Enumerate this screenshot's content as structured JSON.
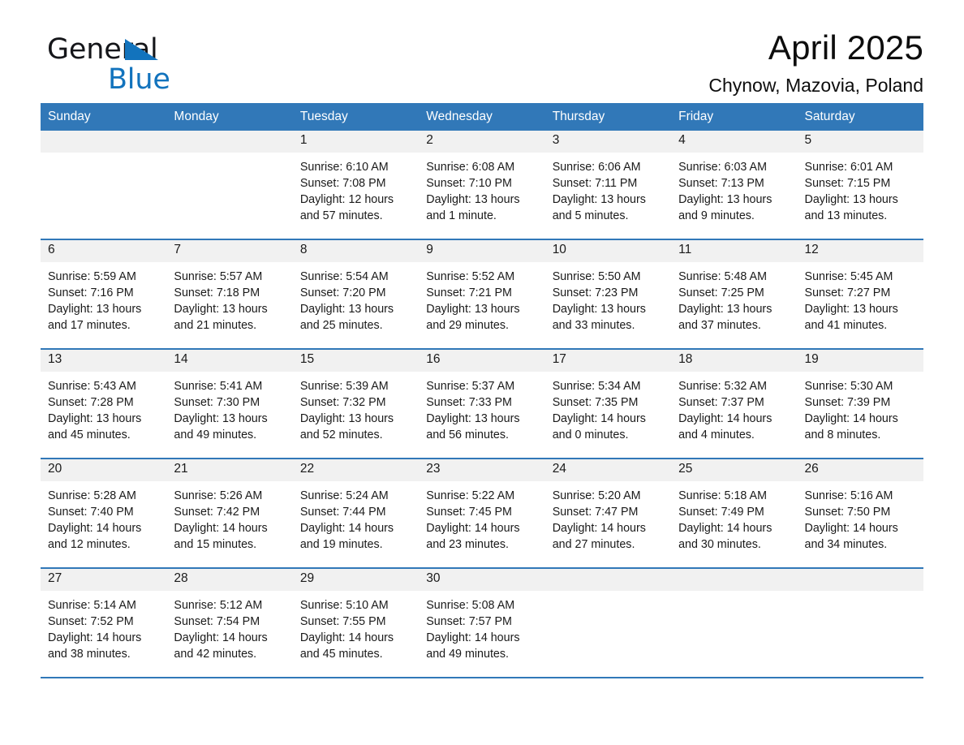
{
  "brand": {
    "name_part1": "General",
    "name_part2": "Blue",
    "triangle_icon": "triangle-icon",
    "accent_color": "#1273bd"
  },
  "header": {
    "title": "April 2025",
    "location": "Chynow, Mazovia, Poland"
  },
  "theme": {
    "header_blue": "#3178b8",
    "row_rule_blue": "#3178b8",
    "daynum_band": "#f1f1f1",
    "text": "#1a1a1a"
  },
  "weekdays": [
    "Sunday",
    "Monday",
    "Tuesday",
    "Wednesday",
    "Thursday",
    "Friday",
    "Saturday"
  ],
  "labels": {
    "sunrise_prefix": "Sunrise:",
    "sunset_prefix": "Sunset:",
    "daylight_prefix": "Daylight:"
  },
  "weeks": [
    [
      {
        "day": "",
        "sunrise": "",
        "sunset": "",
        "daylight_line1": "",
        "daylight_line2": "",
        "blank": true
      },
      {
        "day": "",
        "sunrise": "",
        "sunset": "",
        "daylight_line1": "",
        "daylight_line2": "",
        "blank": true
      },
      {
        "day": "1",
        "sunrise": "Sunrise: 6:10 AM",
        "sunset": "Sunset: 7:08 PM",
        "daylight_line1": "Daylight: 12 hours",
        "daylight_line2": "and 57 minutes."
      },
      {
        "day": "2",
        "sunrise": "Sunrise: 6:08 AM",
        "sunset": "Sunset: 7:10 PM",
        "daylight_line1": "Daylight: 13 hours",
        "daylight_line2": "and 1 minute."
      },
      {
        "day": "3",
        "sunrise": "Sunrise: 6:06 AM",
        "sunset": "Sunset: 7:11 PM",
        "daylight_line1": "Daylight: 13 hours",
        "daylight_line2": "and 5 minutes."
      },
      {
        "day": "4",
        "sunrise": "Sunrise: 6:03 AM",
        "sunset": "Sunset: 7:13 PM",
        "daylight_line1": "Daylight: 13 hours",
        "daylight_line2": "and 9 minutes."
      },
      {
        "day": "5",
        "sunrise": "Sunrise: 6:01 AM",
        "sunset": "Sunset: 7:15 PM",
        "daylight_line1": "Daylight: 13 hours",
        "daylight_line2": "and 13 minutes."
      }
    ],
    [
      {
        "day": "6",
        "sunrise": "Sunrise: 5:59 AM",
        "sunset": "Sunset: 7:16 PM",
        "daylight_line1": "Daylight: 13 hours",
        "daylight_line2": "and 17 minutes."
      },
      {
        "day": "7",
        "sunrise": "Sunrise: 5:57 AM",
        "sunset": "Sunset: 7:18 PM",
        "daylight_line1": "Daylight: 13 hours",
        "daylight_line2": "and 21 minutes."
      },
      {
        "day": "8",
        "sunrise": "Sunrise: 5:54 AM",
        "sunset": "Sunset: 7:20 PM",
        "daylight_line1": "Daylight: 13 hours",
        "daylight_line2": "and 25 minutes."
      },
      {
        "day": "9",
        "sunrise": "Sunrise: 5:52 AM",
        "sunset": "Sunset: 7:21 PM",
        "daylight_line1": "Daylight: 13 hours",
        "daylight_line2": "and 29 minutes."
      },
      {
        "day": "10",
        "sunrise": "Sunrise: 5:50 AM",
        "sunset": "Sunset: 7:23 PM",
        "daylight_line1": "Daylight: 13 hours",
        "daylight_line2": "and 33 minutes."
      },
      {
        "day": "11",
        "sunrise": "Sunrise: 5:48 AM",
        "sunset": "Sunset: 7:25 PM",
        "daylight_line1": "Daylight: 13 hours",
        "daylight_line2": "and 37 minutes."
      },
      {
        "day": "12",
        "sunrise": "Sunrise: 5:45 AM",
        "sunset": "Sunset: 7:27 PM",
        "daylight_line1": "Daylight: 13 hours",
        "daylight_line2": "and 41 minutes."
      }
    ],
    [
      {
        "day": "13",
        "sunrise": "Sunrise: 5:43 AM",
        "sunset": "Sunset: 7:28 PM",
        "daylight_line1": "Daylight: 13 hours",
        "daylight_line2": "and 45 minutes."
      },
      {
        "day": "14",
        "sunrise": "Sunrise: 5:41 AM",
        "sunset": "Sunset: 7:30 PM",
        "daylight_line1": "Daylight: 13 hours",
        "daylight_line2": "and 49 minutes."
      },
      {
        "day": "15",
        "sunrise": "Sunrise: 5:39 AM",
        "sunset": "Sunset: 7:32 PM",
        "daylight_line1": "Daylight: 13 hours",
        "daylight_line2": "and 52 minutes."
      },
      {
        "day": "16",
        "sunrise": "Sunrise: 5:37 AM",
        "sunset": "Sunset: 7:33 PM",
        "daylight_line1": "Daylight: 13 hours",
        "daylight_line2": "and 56 minutes."
      },
      {
        "day": "17",
        "sunrise": "Sunrise: 5:34 AM",
        "sunset": "Sunset: 7:35 PM",
        "daylight_line1": "Daylight: 14 hours",
        "daylight_line2": "and 0 minutes."
      },
      {
        "day": "18",
        "sunrise": "Sunrise: 5:32 AM",
        "sunset": "Sunset: 7:37 PM",
        "daylight_line1": "Daylight: 14 hours",
        "daylight_line2": "and 4 minutes."
      },
      {
        "day": "19",
        "sunrise": "Sunrise: 5:30 AM",
        "sunset": "Sunset: 7:39 PM",
        "daylight_line1": "Daylight: 14 hours",
        "daylight_line2": "and 8 minutes."
      }
    ],
    [
      {
        "day": "20",
        "sunrise": "Sunrise: 5:28 AM",
        "sunset": "Sunset: 7:40 PM",
        "daylight_line1": "Daylight: 14 hours",
        "daylight_line2": "and 12 minutes."
      },
      {
        "day": "21",
        "sunrise": "Sunrise: 5:26 AM",
        "sunset": "Sunset: 7:42 PM",
        "daylight_line1": "Daylight: 14 hours",
        "daylight_line2": "and 15 minutes."
      },
      {
        "day": "22",
        "sunrise": "Sunrise: 5:24 AM",
        "sunset": "Sunset: 7:44 PM",
        "daylight_line1": "Daylight: 14 hours",
        "daylight_line2": "and 19 minutes."
      },
      {
        "day": "23",
        "sunrise": "Sunrise: 5:22 AM",
        "sunset": "Sunset: 7:45 PM",
        "daylight_line1": "Daylight: 14 hours",
        "daylight_line2": "and 23 minutes."
      },
      {
        "day": "24",
        "sunrise": "Sunrise: 5:20 AM",
        "sunset": "Sunset: 7:47 PM",
        "daylight_line1": "Daylight: 14 hours",
        "daylight_line2": "and 27 minutes."
      },
      {
        "day": "25",
        "sunrise": "Sunrise: 5:18 AM",
        "sunset": "Sunset: 7:49 PM",
        "daylight_line1": "Daylight: 14 hours",
        "daylight_line2": "and 30 minutes."
      },
      {
        "day": "26",
        "sunrise": "Sunrise: 5:16 AM",
        "sunset": "Sunset: 7:50 PM",
        "daylight_line1": "Daylight: 14 hours",
        "daylight_line2": "and 34 minutes."
      }
    ],
    [
      {
        "day": "27",
        "sunrise": "Sunrise: 5:14 AM",
        "sunset": "Sunset: 7:52 PM",
        "daylight_line1": "Daylight: 14 hours",
        "daylight_line2": "and 38 minutes."
      },
      {
        "day": "28",
        "sunrise": "Sunrise: 5:12 AM",
        "sunset": "Sunset: 7:54 PM",
        "daylight_line1": "Daylight: 14 hours",
        "daylight_line2": "and 42 minutes."
      },
      {
        "day": "29",
        "sunrise": "Sunrise: 5:10 AM",
        "sunset": "Sunset: 7:55 PM",
        "daylight_line1": "Daylight: 14 hours",
        "daylight_line2": "and 45 minutes."
      },
      {
        "day": "30",
        "sunrise": "Sunrise: 5:08 AM",
        "sunset": "Sunset: 7:57 PM",
        "daylight_line1": "Daylight: 14 hours",
        "daylight_line2": "and 49 minutes."
      },
      {
        "day": "",
        "sunrise": "",
        "sunset": "",
        "daylight_line1": "",
        "daylight_line2": "",
        "blank": true
      },
      {
        "day": "",
        "sunrise": "",
        "sunset": "",
        "daylight_line1": "",
        "daylight_line2": "",
        "blank": true
      },
      {
        "day": "",
        "sunrise": "",
        "sunset": "",
        "daylight_line1": "",
        "daylight_line2": "",
        "blank": true
      }
    ]
  ]
}
